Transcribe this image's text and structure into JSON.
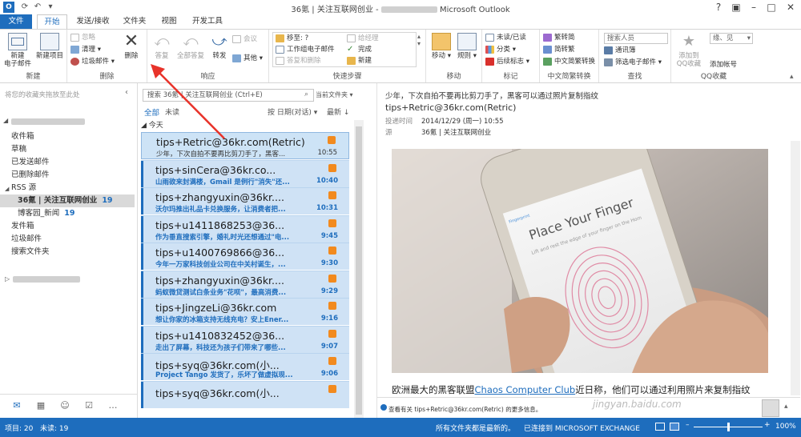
{
  "window": {
    "title": "36氪 | 关注互联网创业 -",
    "app": "Microsoft Outlook",
    "blurred_title_part": ""
  },
  "tabs": [
    {
      "label": "文件"
    },
    {
      "label": "开始"
    },
    {
      "label": "发送/接收"
    },
    {
      "label": "文件夹"
    },
    {
      "label": "视图"
    },
    {
      "label": "开发工具"
    }
  ],
  "ribbon": {
    "new": {
      "new_email": "新建\n电子邮件",
      "new_items": "新建项目",
      "group": "新建"
    },
    "delete": {
      "ignore": "忽略",
      "cleanup": "清理",
      "junk": "垃圾邮件",
      "delete": "删除",
      "group": "删除"
    },
    "respond": {
      "reply": "答复",
      "reply_all": "全部答复",
      "forward": "转发",
      "meeting": "会议",
      "more": "其他",
      "group": "响应"
    },
    "quicksteps": {
      "move_to": "移至: ?",
      "to_manager": "给经理",
      "team_email": "工作组电子邮件",
      "done": "完成",
      "reply_delete": "答复和删除",
      "new": "新建",
      "group": "快速步骤"
    },
    "move": {
      "move": "移动",
      "rules": "规则",
      "group": "移动"
    },
    "tags": {
      "unread_read": "未读/已读",
      "categorize": "分类",
      "followup": "后续标志",
      "group": "标记"
    },
    "chinese": {
      "to_trad": "繁转简",
      "to_simp": "简转繁",
      "convert": "中文简繁转换",
      "group": "中文简繁转换"
    },
    "find": {
      "search_people": "搜索人员",
      "address_book": "通讯簿",
      "filter_email": "筛选电子邮件",
      "group": "查找"
    },
    "qq": {
      "add_qq": "添加到\nQQ收藏",
      "add_account": "添加帐号",
      "account_value": "缘、见",
      "group": "QQ收藏"
    }
  },
  "leftpane": {
    "favorites_hint": "将您的收藏夹拖放至此处",
    "folders": [
      {
        "label": "收件箱"
      },
      {
        "label": "草稿"
      },
      {
        "label": "已发送邮件"
      },
      {
        "label": "已删除邮件"
      },
      {
        "label": "RSS 源"
      },
      {
        "label": "36氪 | 关注互联网创业",
        "count": "19"
      },
      {
        "label": "博客园_新闻",
        "count": "19"
      },
      {
        "label": "发件箱"
      },
      {
        "label": "垃圾邮件"
      },
      {
        "label": "搜索文件夹"
      }
    ]
  },
  "list": {
    "search_placeholder": "搜索 36氪 | 关注互联网创业 (Ctrl+E)",
    "scope": "当前文件夹",
    "filter_all": "全部",
    "filter_unread": "未读",
    "sort_by": "按 日期(对话)",
    "sort_order": "最新",
    "group_today": "今天",
    "messages": [
      {
        "from": "tips+Retric@36kr.com(Retric)",
        "subject": "少年，下次自拍不要再比剪刀手了，黑客...",
        "time": "10:55"
      },
      {
        "from": "tips+sinCera@36kr.co...",
        "subject": "山雨欲来封满楼，Gmail 是例行\"消失\"还...",
        "time": "10:40"
      },
      {
        "from": "tips+zhangyuxin@36kr....",
        "subject": "沃尔玛推出礼品卡兑换服务，让消费者把...",
        "time": "10:31"
      },
      {
        "from": "tips+u1411868253@36...",
        "subject": "作为垂直搜索引擎，婚礼时光还想通过\"电...",
        "time": "9:45"
      },
      {
        "from": "tips+u1400769866@36...",
        "subject": "今年一万家科技创业公司在中关村诞生，...",
        "time": "9:30"
      },
      {
        "from": "tips+zhangyuxin@36kr....",
        "subject": "蚂蚁微贷测试白条业务\"花呗\"，最高消费...",
        "time": "9:29"
      },
      {
        "from": "tips+JingzeLi@36kr.com",
        "subject": "想让你家的冰箱支持无线充电？安上Ener...",
        "time": "9:16"
      },
      {
        "from": "tips+u1410832452@36...",
        "subject": "走出了屏幕，科技还为孩子们带来了哪些...",
        "time": "9:07"
      },
      {
        "from": "tips+syq@36kr.com(小...",
        "subject": "Project Tango 发货了，乐坏了做虚拟现...",
        "time": "9:06"
      },
      {
        "from": "tips+syq@36kr.com(小...",
        "subject": "",
        "time": ""
      }
    ]
  },
  "reading": {
    "subject": "少年，下次自拍不要再比剪刀手了，黑客可以通过照片复制指纹",
    "from": "tips+Retric@36kr.com(Retric)",
    "sent_label": "投递时间",
    "sent_value": "2014/12/29 (周一) 10:55",
    "source_label": "源",
    "source_value": "36氪 | 关注互联网创业",
    "phone_title": "Place Your Finger",
    "phone_brand": "Fingerprint",
    "phone_instr": "Lift and rest the edge of your finger on the Home button repeatedly.",
    "body_prefix": "欧洲最大的黑客联盟",
    "body_link": "Chaos Computer Club",
    "body_suffix": "近日称，他们可以通过利用照片来复制指纹",
    "info_bar": "查看有关 tips+Retric@36kr.com(Retric) 的更多信息。"
  },
  "status": {
    "items": "项目: 20",
    "unread": "未读: 19",
    "uptodate": "所有文件夹都是最新的。",
    "connected": "已连接到 MICROSOFT EXCHANGE",
    "zoom": "100%"
  },
  "watermark": "jingyan.baidu.com"
}
